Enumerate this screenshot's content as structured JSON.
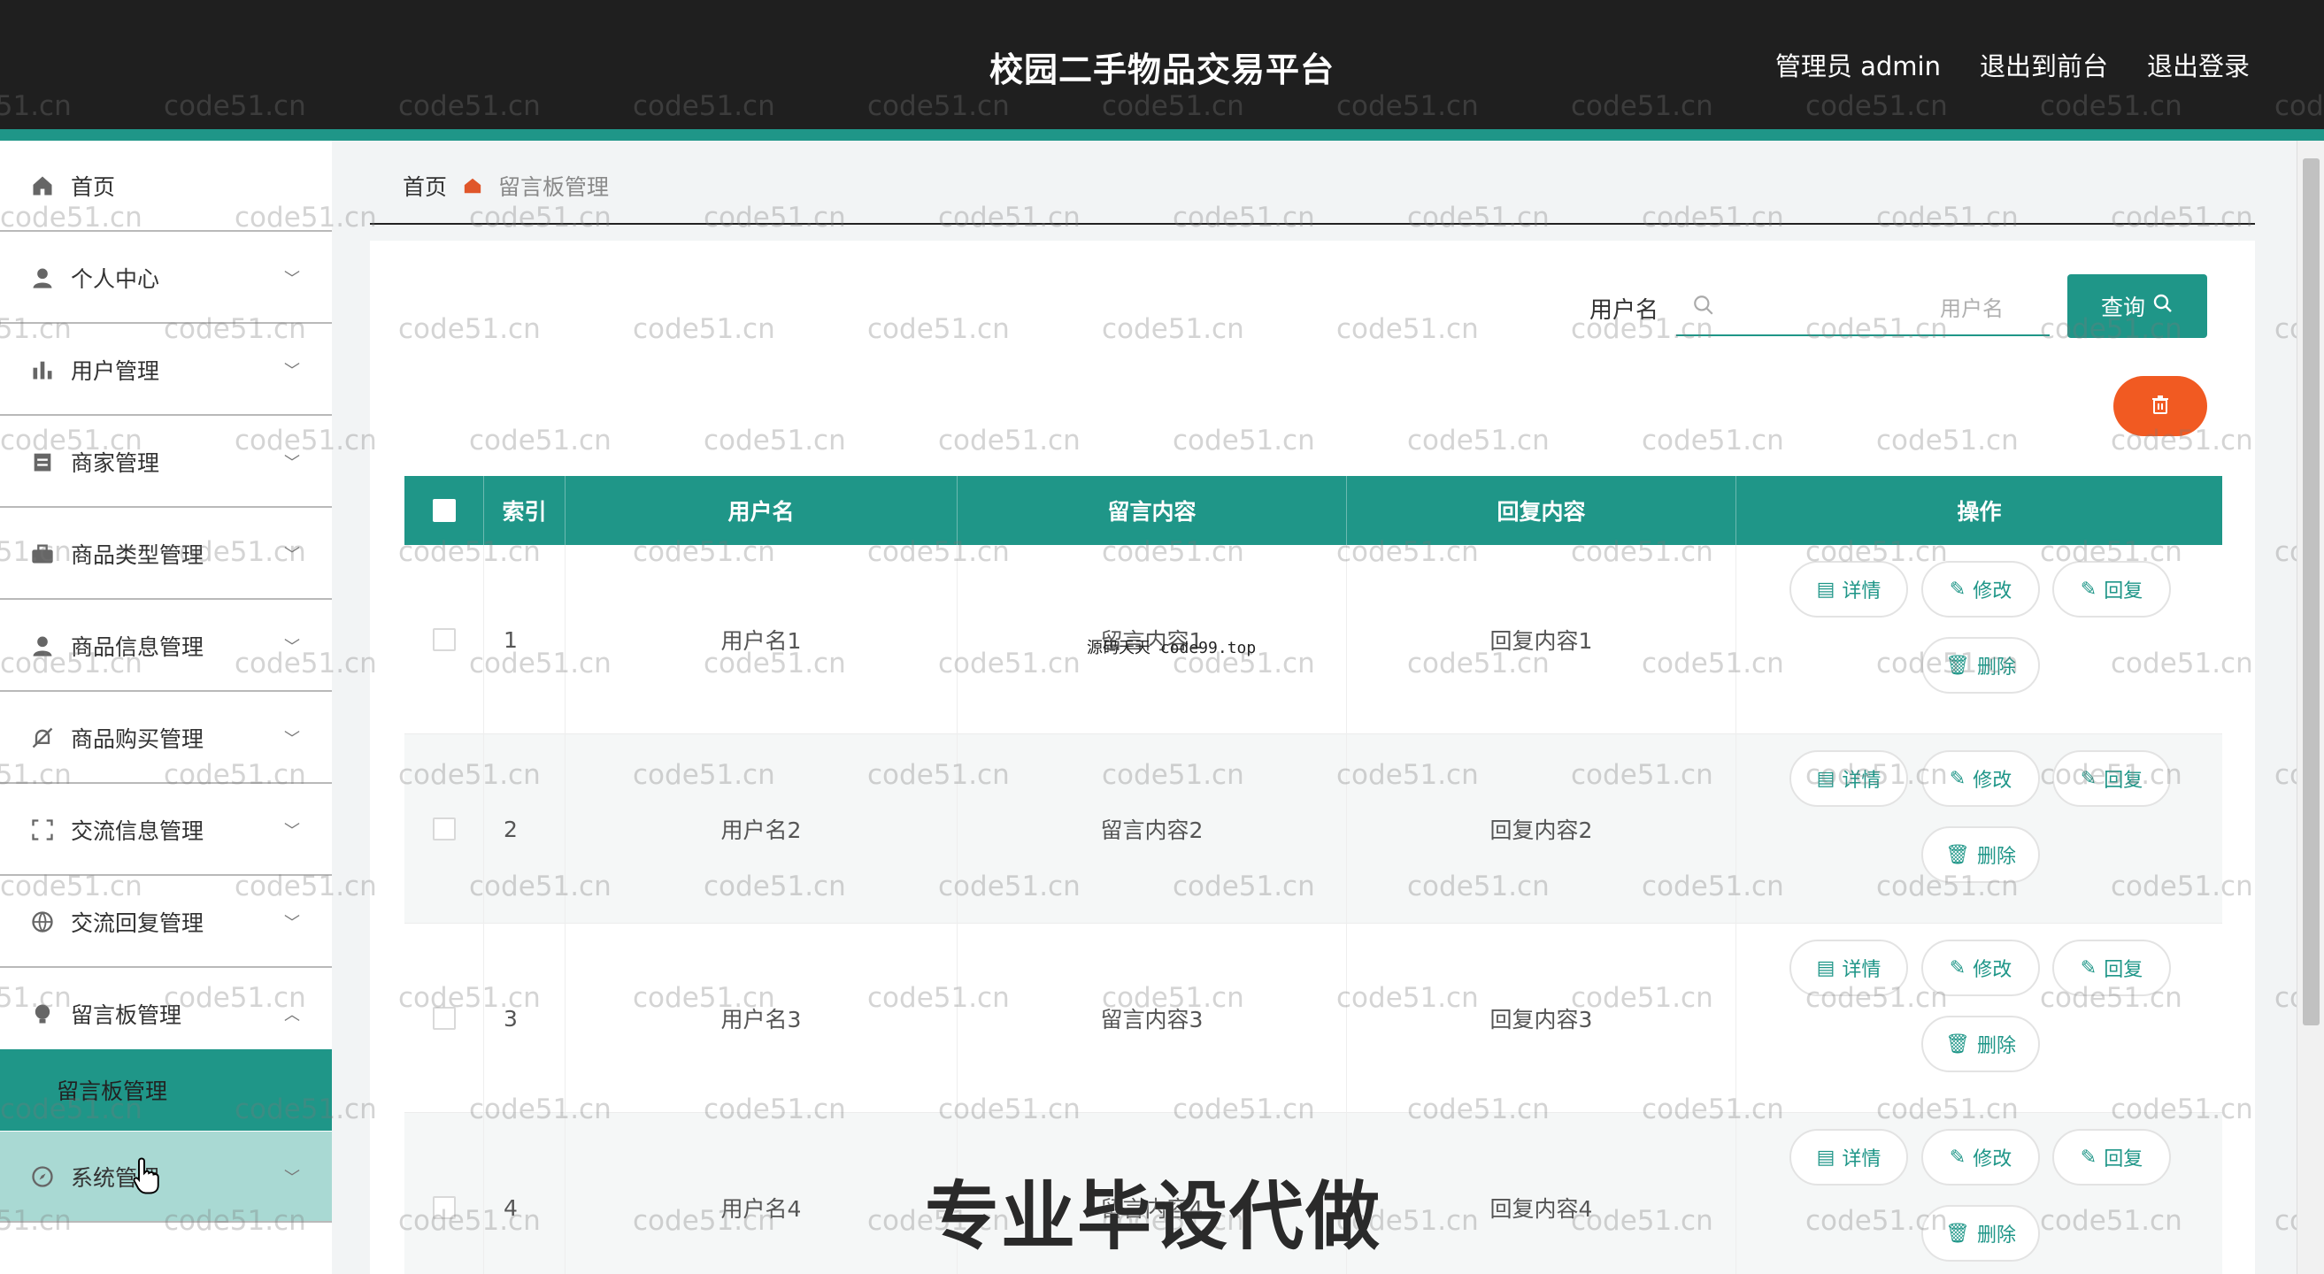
{
  "app": {
    "title": "校园二手物品交易平台",
    "admin_label": "管理员 admin",
    "exit_front": "退出到前台",
    "logout": "退出登录"
  },
  "sidebar": {
    "items": [
      {
        "label": "首页",
        "icon": "home-icon"
      },
      {
        "label": "个人中心",
        "icon": "user-icon"
      },
      {
        "label": "用户管理",
        "icon": "bar-chart-icon"
      },
      {
        "label": "商家管理",
        "icon": "calendar-icon"
      },
      {
        "label": "商品类型管理",
        "icon": "briefcase-icon"
      },
      {
        "label": "商品信息管理",
        "icon": "user-icon"
      },
      {
        "label": "商品购买管理",
        "icon": "bell-off-icon"
      },
      {
        "label": "交流信息管理",
        "icon": "frame-icon"
      },
      {
        "label": "交流回复管理",
        "icon": "globe-icon"
      },
      {
        "label": "留言板管理",
        "icon": "bulb-icon"
      }
    ],
    "sub_item": "留言板管理",
    "system": "系统管理"
  },
  "breadcrumb": {
    "home": "首页",
    "current": "留言板管理"
  },
  "search": {
    "label": "用户名",
    "placeholder": "用户名",
    "button": "查询"
  },
  "table": {
    "headers": {
      "index": "索引",
      "username": "用户名",
      "message": "留言内容",
      "reply": "回复内容",
      "actions": "操作"
    },
    "rows": [
      {
        "index": "1",
        "username": "用户名1",
        "message": "留言内容1",
        "reply": "回复内容1"
      },
      {
        "index": "2",
        "username": "用户名2",
        "message": "留言内容2",
        "reply": "回复内容2"
      },
      {
        "index": "3",
        "username": "用户名3",
        "message": "留言内容3",
        "reply": "回复内容3"
      },
      {
        "index": "4",
        "username": "用户名4",
        "message": "留言内容4",
        "reply": "回复内容4"
      }
    ],
    "actions": {
      "detail": "详情",
      "edit": "修改",
      "reply": "回复",
      "delete": "删除"
    }
  },
  "overlay": {
    "big": "专业毕设代做",
    "small": "源码天天 code99.top"
  },
  "watermark": "code51.cn",
  "colors": {
    "accent": "#1f9688",
    "header_bg": "#1f1f1f",
    "delete_fab": "#f15a22"
  }
}
